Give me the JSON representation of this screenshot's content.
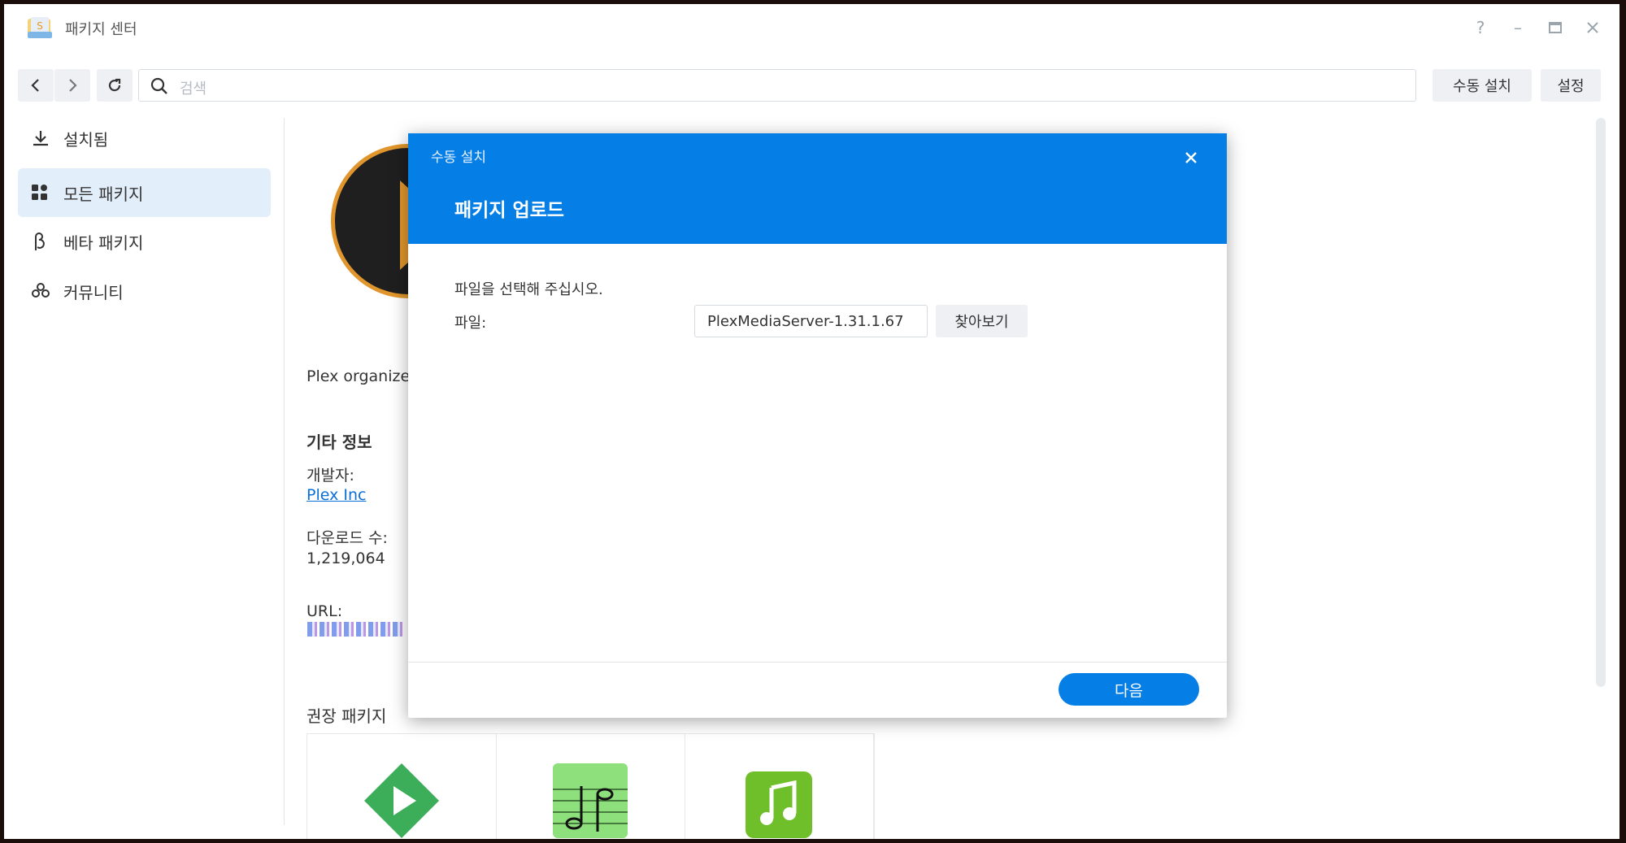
{
  "window": {
    "title": "패키지 센터",
    "controls": [
      "help-icon",
      "minimize-icon",
      "maximize-icon",
      "close-icon"
    ]
  },
  "toolbar": {
    "search_placeholder": "검색",
    "manual_install_label": "수동 설치",
    "settings_label": "설정"
  },
  "sidebar": {
    "items": [
      {
        "label": "설치됨",
        "icon": "download-icon",
        "active": false
      },
      {
        "label": "모든 패키지",
        "icon": "grid-icon",
        "active": true
      },
      {
        "label": "베타 패키지",
        "icon": "beta-icon",
        "active": false
      },
      {
        "label": "커뮤니티",
        "icon": "community-icon",
        "active": false
      }
    ]
  },
  "main": {
    "description_snippet": "Plex organize",
    "other_info_heading": "기타 정보",
    "developer_label": "개발자:",
    "developer_value": "Plex Inc",
    "downloads_label": "다운로드 수:",
    "downloads_value": "1,219,064",
    "url_label": "URL:",
    "recommended_heading": "권장 패키지"
  },
  "modal": {
    "caption": "수동 설치",
    "title": "패키지 업로드",
    "prompt": "파일을 선택해 주십시오.",
    "file_label": "파일:",
    "file_value": "PlexMediaServer-1.31.1.67",
    "browse_label": "찾아보기",
    "next_label": "다음"
  },
  "colors": {
    "accent": "#057ee6",
    "sidebar_active": "#e3eefb",
    "plex_orange": "#e0962c"
  }
}
